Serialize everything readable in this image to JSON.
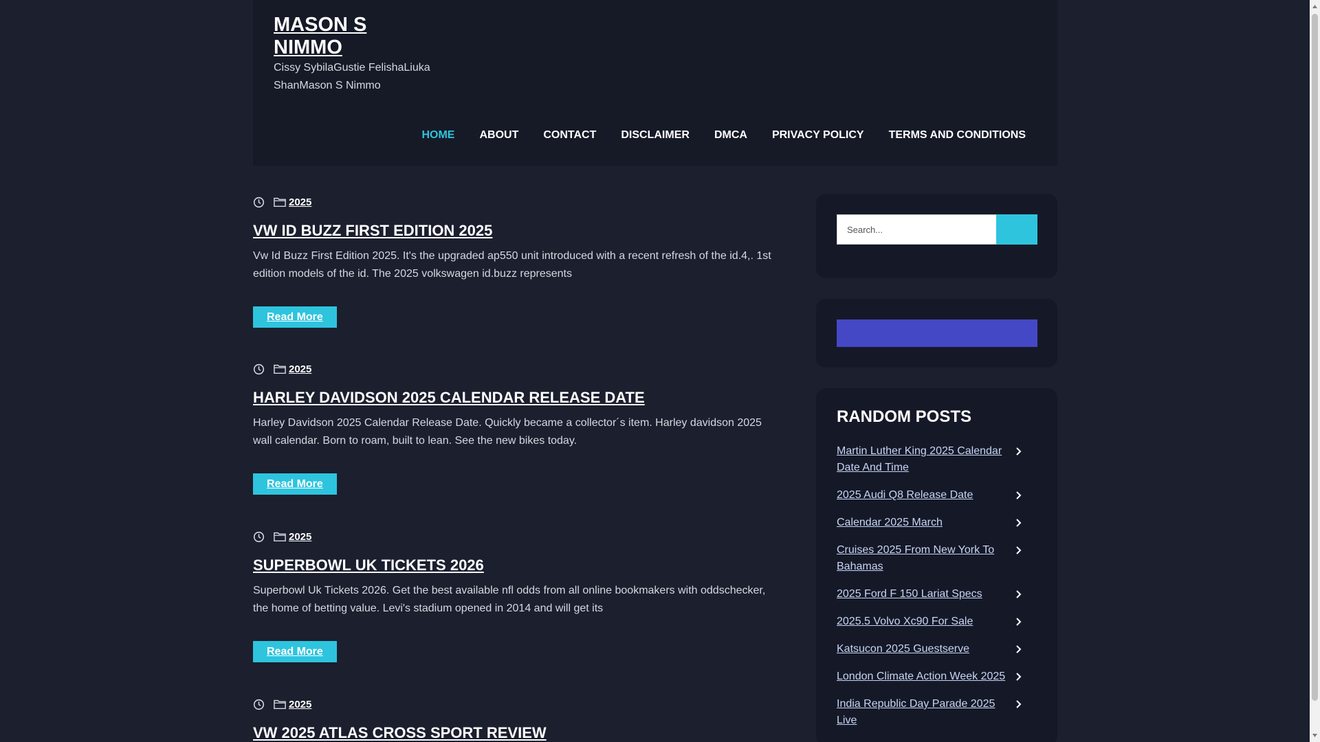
{
  "site": {
    "title": "MASON S NIMMO",
    "description": "Cissy SybilaGustie FelishaLiuka ShanMason S Nimmo"
  },
  "nav": [
    {
      "label": "HOME",
      "active": true
    },
    {
      "label": "ABOUT"
    },
    {
      "label": "CONTACT"
    },
    {
      "label": "DISCLAIMER"
    },
    {
      "label": "DMCA"
    },
    {
      "label": "PRIVACY POLICY"
    },
    {
      "label": "TERMS AND CONDITIONS"
    }
  ],
  "posts": [
    {
      "category": "2025",
      "title": "VW ID BUZZ FIRST EDITION 2025",
      "excerpt": "Vw Id Buzz First Edition 2025. It's the upgraded ap550 unit introduced with a recent refresh of the id.4,. 1st edition models of the id. The 2025 volkswagen id.buzz represents",
      "read_more": "Read More"
    },
    {
      "category": "2025",
      "title": "HARLEY DAVIDSON 2025 CALENDAR RELEASE DATE",
      "excerpt": "Harley Davidson 2025 Calendar Release Date. Quickly became a collector´s item. Harley davidson 2025 wall calendar. Born to roam, built to lean. See the new bikes today.",
      "read_more": "Read More"
    },
    {
      "category": "2025",
      "title": "SUPERBOWL UK TICKETS 2026",
      "excerpt": "Superbowl Uk Tickets 2026. Get the best available nfl odds from all online bookmakers with oddschecker, the home of betting value. Levi's stadium opened in 2014 and will get its",
      "read_more": "Read More"
    },
    {
      "category": "2025",
      "title": "VW 2025 ATLAS CROSS SPORT REVIEW",
      "excerpt": "",
      "read_more": ""
    }
  ],
  "search": {
    "placeholder": "Search..."
  },
  "random_posts": {
    "title": "RANDOM POSTS",
    "items": [
      "Martin Luther King 2025 Calendar Date And Time",
      "2025 Audi Q8 Release Date",
      "Calendar 2025 March",
      "Cruises 2025 From New York To Bahamas",
      "2025 Ford F 150 Lariat Specs",
      "2025.5 Volvo Xc90 For Sale",
      "Katsucon 2025 Guestserve",
      "London Climate Action Week 2025",
      "India Republic Day Parade 2025 Live"
    ]
  },
  "colors": {
    "background": "#1b1f2e",
    "header": "#161a27",
    "accent": "#2ec4de",
    "widget_bar": "#4548c4"
  },
  "icons": {
    "meta_time": "clock-icon",
    "meta_category": "folder-icon",
    "list_arrow": "chevron-right-icon"
  }
}
